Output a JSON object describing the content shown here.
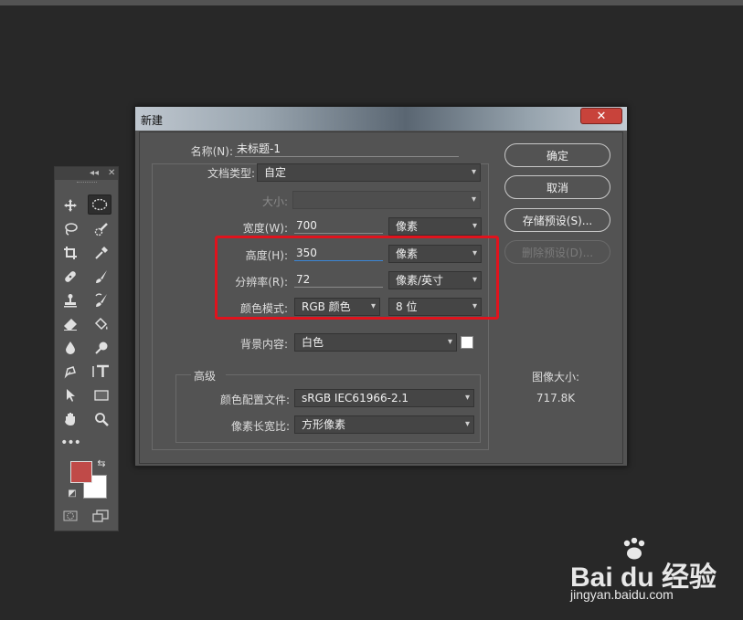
{
  "dialog": {
    "title": "新建",
    "close_label": "✕",
    "name_label": "名称(N):",
    "name_value": "未标题-1",
    "doc_type_label": "文档类型:",
    "doc_type_value": "自定",
    "size_label": "大小:",
    "size_value": "",
    "width_label": "宽度(W):",
    "width_value": "700",
    "width_unit": "像素",
    "height_label": "高度(H):",
    "height_value": "350",
    "height_unit": "像素",
    "resolution_label": "分辨率(R):",
    "resolution_value": "72",
    "resolution_unit": "像素/英寸",
    "color_mode_label": "颜色模式:",
    "color_mode_value": "RGB 颜色",
    "bit_depth_value": "8 位",
    "background_label": "背景内容:",
    "background_value": "白色",
    "advanced_label": "高级",
    "color_profile_label": "颜色配置文件:",
    "color_profile_value": "sRGB IEC61966-2.1",
    "pixel_aspect_label": "像素长宽比:",
    "pixel_aspect_value": "方形像素",
    "buttons": {
      "ok": "确定",
      "cancel": "取消",
      "save_preset": "存储预设(S)...",
      "delete_preset": "删除预设(D)..."
    },
    "image_size_label": "图像大小:",
    "image_size_value": "717.8K"
  },
  "toolbar": {
    "collapse_label": "◂◂",
    "close_label": "✕",
    "tools": [
      "move-tool",
      "ellipse-marquee-tool",
      "lasso-tool",
      "quick-selection-tool",
      "crop-tool",
      "eyedropper-tool",
      "healing-brush-tool",
      "brush-tool",
      "clone-stamp-tool",
      "history-brush-tool",
      "eraser-tool",
      "paint-bucket-tool",
      "blur-tool",
      "dodge-tool",
      "pen-tool",
      "type-tool",
      "path-selection-tool",
      "rectangle-tool",
      "hand-tool",
      "zoom-tool",
      "more-tools"
    ],
    "foreground_color": "#c04a48",
    "background_color": "#ffffff"
  },
  "watermark": {
    "logo": "Bai du 经验",
    "site": "jingyan.baidu.com"
  }
}
